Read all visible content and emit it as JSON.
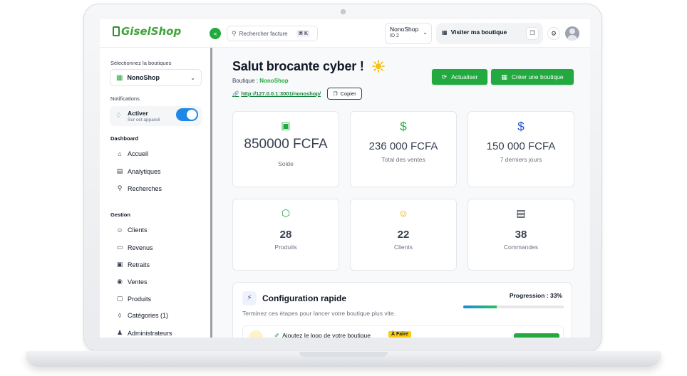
{
  "brand": {
    "logo_text": "GiselShop"
  },
  "topbar": {
    "search_placeholder": "Rechercher facture",
    "search_shortcut": "⌘ K",
    "shop_name": "NonoShop",
    "shop_id": "ID 2",
    "visit_label": "Visiter ma boutique"
  },
  "sidebar": {
    "select_label": "Sélectionnez la boutiques",
    "selected_shop": "NonoShop",
    "notifications_label": "Notifications",
    "notif_title": "Activer",
    "notif_sub": "Sur cet appareil",
    "notif_enabled": true,
    "dashboard_heading": "Dashboard",
    "dashboard_items": [
      {
        "label": "Accueil",
        "icon": "home-icon"
      },
      {
        "label": "Analytiques",
        "icon": "chart-icon"
      },
      {
        "label": "Recherches",
        "icon": "search-icon"
      }
    ],
    "gestion_heading": "Gestion",
    "gestion_items": [
      {
        "label": "Clients",
        "icon": "users-icon"
      },
      {
        "label": "Revenus",
        "icon": "money-icon"
      },
      {
        "label": "Retraits",
        "icon": "wallet-icon"
      },
      {
        "label": "Ventes",
        "icon": "tag-icon"
      },
      {
        "label": "Produits",
        "icon": "box-icon"
      },
      {
        "label": "Catégories (1)",
        "icon": "category-icon"
      },
      {
        "label": "Administrateurs",
        "icon": "admin-icon"
      }
    ]
  },
  "main": {
    "greeting": "Salut brocante cyber !",
    "boutique_prefix": "Boutique : ",
    "boutique_name": "NonoShop",
    "url": "http://127.0.0.1:3001/nonoshop/",
    "copy_label": "Copier",
    "refresh_label": "Actualiser",
    "create_label": "Créer une boutique"
  },
  "stats": [
    {
      "value": "850000 FCFA",
      "label": "Solde",
      "icon": "wallet-icon",
      "color": "#22a93f"
    },
    {
      "value": "236 000 FCFA",
      "label": "Total des ventes",
      "icon": "dollar-icon",
      "color": "#22a93f"
    },
    {
      "value": "150 000 FCFA",
      "label": "7 derniers jours",
      "icon": "dollar-icon",
      "color": "#1e4fd8"
    },
    {
      "value": "28",
      "label": "Produits",
      "icon": "box-icon",
      "color": "#22a93f"
    },
    {
      "value": "22",
      "label": "Clients",
      "icon": "users-icon",
      "color": "#e0a400"
    },
    {
      "value": "38",
      "label": "Commandes",
      "icon": "receipt-icon",
      "color": "#1f2937"
    }
  ],
  "config": {
    "title": "Configuration rapide",
    "subtitle": "Terminez ces étapes pour lancer votre boutique plus vite.",
    "progress_label": "Progression : 33%",
    "progress": 0.33,
    "step_label": "Ajoutez le logo de votre boutique",
    "step_badge": "À Faire"
  },
  "colors": {
    "accent": "#22a93f",
    "toggle": "#1e88e5"
  }
}
